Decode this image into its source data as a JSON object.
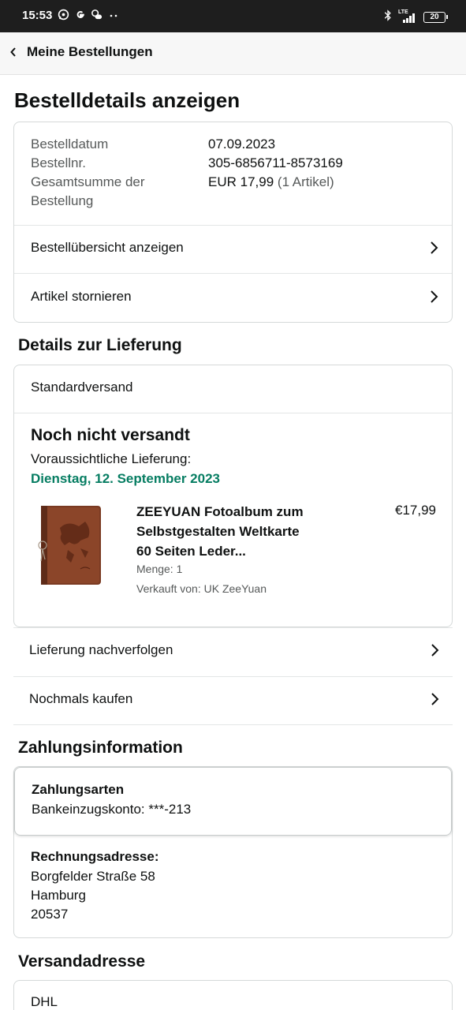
{
  "status_bar": {
    "time": "15:53",
    "icons": [
      "whatsapp-icon",
      "google-icon",
      "weather-icon",
      "more-dots-icon"
    ],
    "right_icons": [
      "bluetooth-icon",
      "lte-signal-icon",
      "battery-icon"
    ],
    "lte": "LTE",
    "battery": "20"
  },
  "nav": {
    "back_label": "Meine Bestellungen"
  },
  "page_title": "Bestelldetails anzeigen",
  "order": {
    "date_label": "Bestelldatum",
    "date_value": "07.09.2023",
    "number_label": "Bestellnr.",
    "number_value": "305-6856711-8573169",
    "total_label_1": "Gesamtsumme der",
    "total_label_2": "Bestellung",
    "total_value": "EUR 17,99",
    "total_count": "(1 Artikel)",
    "summary_link": "Bestellübersicht anzeigen",
    "cancel_link": "Artikel stornieren"
  },
  "delivery": {
    "heading": "Details zur Lieferung",
    "method": "Standardversand",
    "status": "Noch nicht versandt",
    "expected_label": "Voraussichtliche Lieferung:",
    "expected_date": "Dienstag, 12. September 2023",
    "expected_color": "#067d62",
    "item": {
      "title_1": "ZEEYUAN Fotoalbum zum",
      "title_2": "Selbstgestalten Weltkarte",
      "title_3": "60 Seiten Leder...",
      "price": "€17,99",
      "quantity": "Menge: 1",
      "seller": "Verkauft von: UK ZeeYuan"
    },
    "track_link": "Lieferung nachverfolgen",
    "rebuy_link": "Nochmals kaufen"
  },
  "payment": {
    "heading": "Zahlungsinformation",
    "methods_title": "Zahlungsarten",
    "method_value": "Bankeinzugskonto: ***-213",
    "billing_title": "Rechnungsadresse:",
    "billing_street": "Borgfelder Straße 58",
    "billing_city": "Hamburg",
    "billing_zip": "20537"
  },
  "shipping": {
    "heading": "Versandadresse",
    "carrier": "DHL"
  }
}
